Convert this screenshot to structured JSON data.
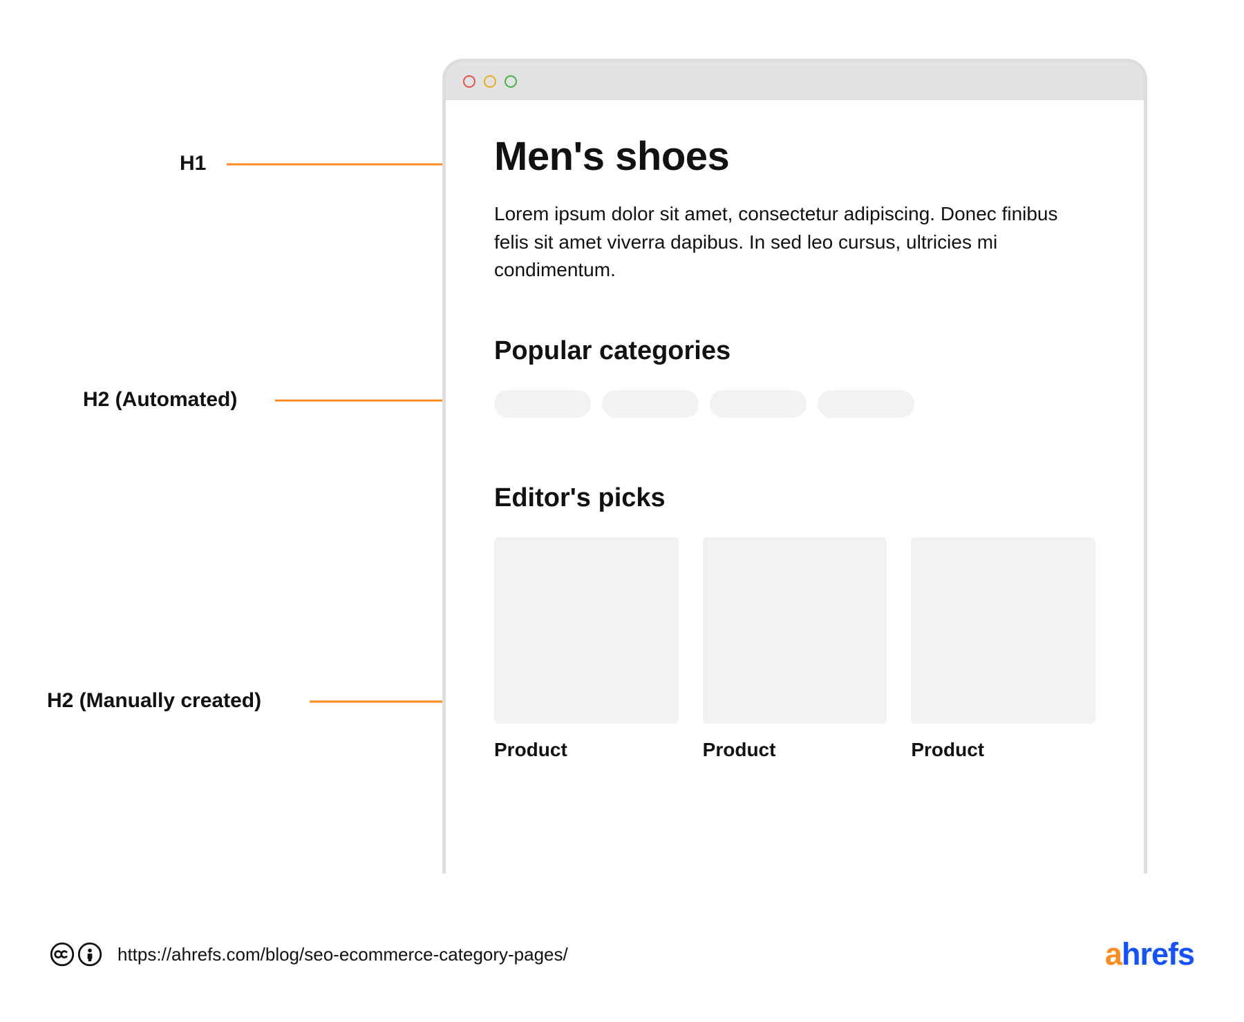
{
  "annotations": {
    "h1": "H1",
    "h2_auto": "H2 (Automated)",
    "h2_manual": "H2 (Manually created)"
  },
  "page": {
    "title": "Men's shoes",
    "body": "Lorem ipsum dolor sit amet, consectetur adipiscing. Donec finibus felis sit amet viverra dapibus. In sed leo cursus, ultricies mi condimentum.",
    "h2_auto": "Popular categories",
    "h2_manual": "Editor's picks",
    "products": [
      {
        "label": "Product"
      },
      {
        "label": "Product"
      },
      {
        "label": "Product"
      }
    ]
  },
  "footer": {
    "url": "https://ahrefs.com/blog/seo-ecommerce-category-pages/",
    "brand_a": "a",
    "brand_rest": "hrefs"
  },
  "colors": {
    "accent": "#ff8b1f",
    "brand_blue": "#1452ff",
    "placeholder": "#f2f2f2",
    "chrome": "#e2e2e2"
  }
}
